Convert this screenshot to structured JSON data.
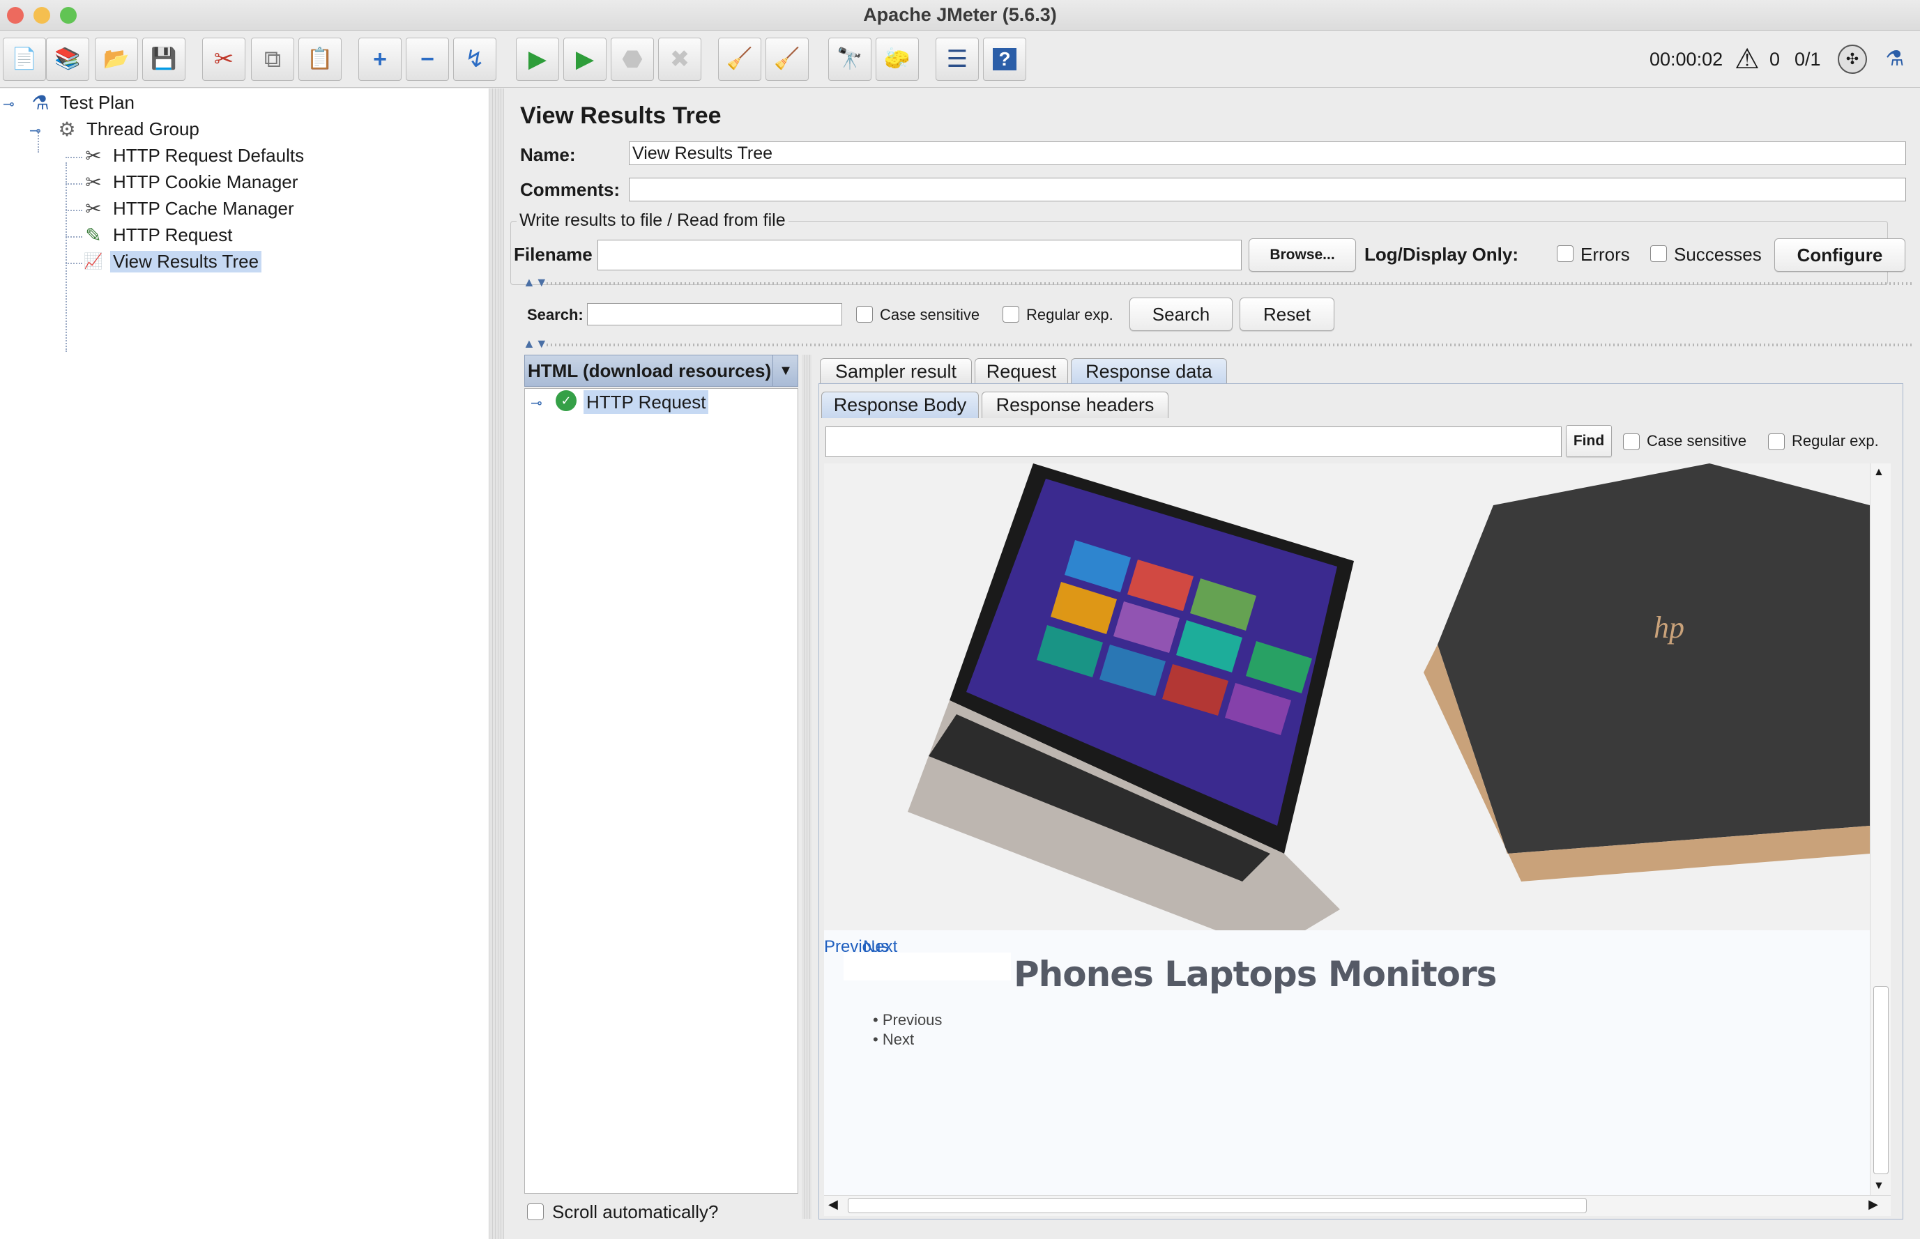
{
  "window": {
    "title": "Apache JMeter (5.6.3)"
  },
  "toolbar": {
    "buttons": [
      {
        "name": "new-icon",
        "glyph": "📄"
      },
      {
        "name": "templates-icon",
        "glyph": "📚"
      },
      {
        "name": "open-icon",
        "glyph": "📂"
      },
      {
        "name": "save-icon",
        "glyph": "💾"
      },
      {
        "name": "cut-icon",
        "glyph": "✂"
      },
      {
        "name": "copy-icon",
        "glyph": "⧉"
      },
      {
        "name": "paste-icon",
        "glyph": "📋"
      },
      {
        "name": "expand-all-icon",
        "glyph": "+"
      },
      {
        "name": "collapse-all-icon",
        "glyph": "−"
      },
      {
        "name": "toggle-icon",
        "glyph": "↯"
      },
      {
        "name": "start-icon",
        "glyph": "▶"
      },
      {
        "name": "start-no-pauses-icon",
        "glyph": "▶"
      },
      {
        "name": "stop-icon",
        "glyph": "⬣"
      },
      {
        "name": "shutdown-icon",
        "glyph": "✖"
      },
      {
        "name": "clear-icon",
        "glyph": "🧹"
      },
      {
        "name": "clear-all-icon",
        "glyph": "🧹"
      },
      {
        "name": "search-icon",
        "glyph": "🔭"
      },
      {
        "name": "reset-search-icon",
        "glyph": "🧽"
      },
      {
        "name": "function-helper-icon",
        "glyph": "☰"
      },
      {
        "name": "help-icon",
        "glyph": "?"
      }
    ],
    "timer": "00:00:02",
    "warning_count": "0",
    "threads": "0/1"
  },
  "tree": {
    "items": [
      {
        "label": "Test Plan",
        "icon": "test-plan-icon",
        "glyph": "⚗"
      },
      {
        "label": "Thread Group",
        "icon": "thread-group-icon",
        "glyph": "⚙"
      },
      {
        "label": "HTTP Request Defaults",
        "icon": "config-element-icon",
        "glyph": "✂"
      },
      {
        "label": "HTTP Cookie Manager",
        "icon": "config-element-icon",
        "glyph": "✂"
      },
      {
        "label": "HTTP Cache Manager",
        "icon": "config-element-icon",
        "glyph": "✂"
      },
      {
        "label": "HTTP Request",
        "icon": "sampler-icon",
        "glyph": "✎"
      },
      {
        "label": "View Results Tree",
        "icon": "listener-icon",
        "glyph": "📈"
      }
    ]
  },
  "panel": {
    "title": "View Results Tree",
    "name_label": "Name:",
    "name_value": "View Results Tree",
    "comments_label": "Comments:",
    "comments_value": "",
    "file_legend": "Write results to file / Read from file",
    "filename_label": "Filename",
    "filename_value": "",
    "browse_label": "Browse...",
    "log_display_label": "Log/Display Only:",
    "errors_label": "Errors",
    "successes_label": "Successes",
    "configure_label": "Configure",
    "search_label": "Search:",
    "search_value": "",
    "case_sensitive_label": "Case sensitive",
    "regex_label": "Regular exp.",
    "search_button": "Search",
    "reset_button": "Reset"
  },
  "renderer": {
    "selected": "HTML (download resources)",
    "results": [
      {
        "label": "HTTP Request",
        "status": "success"
      }
    ],
    "scroll_label": "Scroll automatically?"
  },
  "tabs": {
    "main": [
      "Sampler result",
      "Request",
      "Response data"
    ],
    "active_main": "Response data",
    "sub": [
      "Response Body",
      "Response headers"
    ],
    "active_sub": "Response Body"
  },
  "find": {
    "value": "",
    "button": "Find",
    "case_sensitive_label": "Case sensitive",
    "regex_label": "Regular exp."
  },
  "response": {
    "carousel_prev": "Previous",
    "carousel_next": "Next",
    "categories_heading": "Phones Laptops Monitors",
    "list_items": [
      "Previous",
      "Next"
    ]
  }
}
